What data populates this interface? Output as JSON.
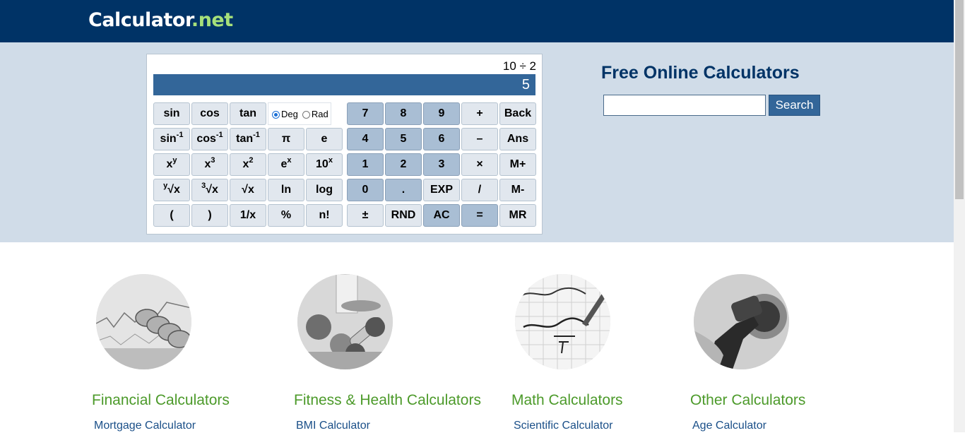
{
  "header": {
    "logo_text": "Calculator",
    "logo_dot": ".",
    "logo_suffix": "net"
  },
  "calculator": {
    "expression": "10 ÷ 2",
    "display_value": "5",
    "angle_mode": {
      "deg_label": "Deg",
      "rad_label": "Rad",
      "selected": "Deg"
    },
    "buttons": {
      "sin": "sin",
      "cos": "cos",
      "tan": "tan",
      "asin_base": "sin",
      "acos_base": "cos",
      "atan_base": "tan",
      "inverse_sup": "-1",
      "pi": "π",
      "e": "e",
      "x": "x",
      "y_sup": "y",
      "three_sup": "3",
      "two_sup": "2",
      "x_sup": "x",
      "ex_base": "e",
      "ten_base": "10",
      "yroot_sup": "y",
      "cuberoot_sup": "3",
      "root_sign": "√",
      "root_x": "x",
      "sqrt": "√x",
      "ln": "ln",
      "log": "log",
      "open_paren": "(",
      "close_paren": ")",
      "reciprocal": "1/x",
      "percent": "%",
      "factorial": "n!",
      "n7": "7",
      "n8": "8",
      "n9": "9",
      "plus": "+",
      "back": "Back",
      "n4": "4",
      "n5": "5",
      "n6": "6",
      "minus": "–",
      "ans": "Ans",
      "n1": "1",
      "n2": "2",
      "n3": "3",
      "multiply": "×",
      "mplus": "M+",
      "n0": "0",
      "dot": ".",
      "exp": "EXP",
      "divide": "/",
      "mminus": "M-",
      "plusminus": "±",
      "rnd": "RND",
      "ac": "AC",
      "equals": "=",
      "mr": "MR"
    }
  },
  "sidebar": {
    "title": "Free Online Calculators",
    "search_placeholder": "",
    "search_button": "Search"
  },
  "categories": [
    {
      "title": "Financial Calculators",
      "link": "Mortgage Calculator",
      "icon": "coins-chart-image"
    },
    {
      "title": "Fitness & Health Calculators",
      "link": "BMI Calculator",
      "icon": "fitness-food-image"
    },
    {
      "title": "Math Calculators",
      "link": "Scientific Calculator",
      "icon": "math-equation-image"
    },
    {
      "title": "Other Calculators",
      "link": "Age Calculator",
      "icon": "fuel-nozzle-image"
    }
  ],
  "colors": {
    "header": "#003366",
    "hero": "#d0dce8",
    "display": "#336699",
    "category_title": "#4c9a2a",
    "link": "#1a4f88"
  }
}
